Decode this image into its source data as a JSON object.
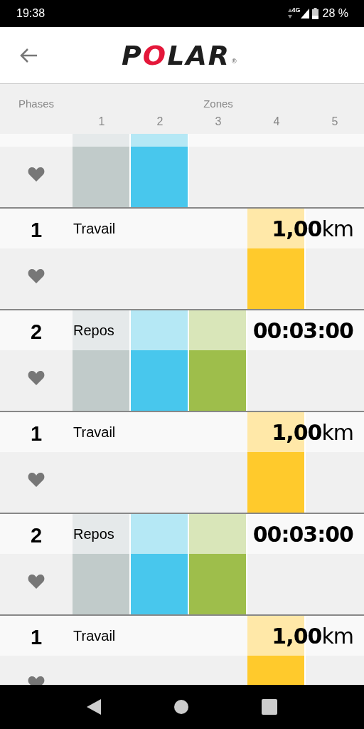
{
  "status_bar": {
    "time": "19:38",
    "network": "4G",
    "battery": "28 %"
  },
  "app_bar": {
    "logo": "POLAR",
    "trademark": "®"
  },
  "header": {
    "phases_label": "Phases",
    "zones_label": "Zones",
    "zones": [
      "1",
      "2",
      "3",
      "4",
      "5"
    ]
  },
  "phases": [
    {
      "zones": [
        true,
        true,
        false,
        false,
        false
      ]
    },
    {
      "number": "1",
      "name": "Travail",
      "value": "**1,00**km",
      "zones": [
        false,
        false,
        false,
        true,
        false
      ]
    },
    {
      "number": "2",
      "name": "Repos",
      "value": "00:03:00",
      "zones": [
        true,
        true,
        true,
        false,
        false
      ]
    },
    {
      "number": "1",
      "name": "Travail",
      "value": "**1,00**km",
      "zones": [
        false,
        false,
        false,
        true,
        false
      ]
    },
    {
      "number": "2",
      "name": "Repos",
      "value": "00:03:00",
      "zones": [
        true,
        true,
        true,
        false,
        false
      ]
    },
    {
      "number": "1",
      "name": "Travail",
      "value": "**1,00**km",
      "zones": [
        false,
        false,
        false,
        true,
        false
      ]
    }
  ]
}
